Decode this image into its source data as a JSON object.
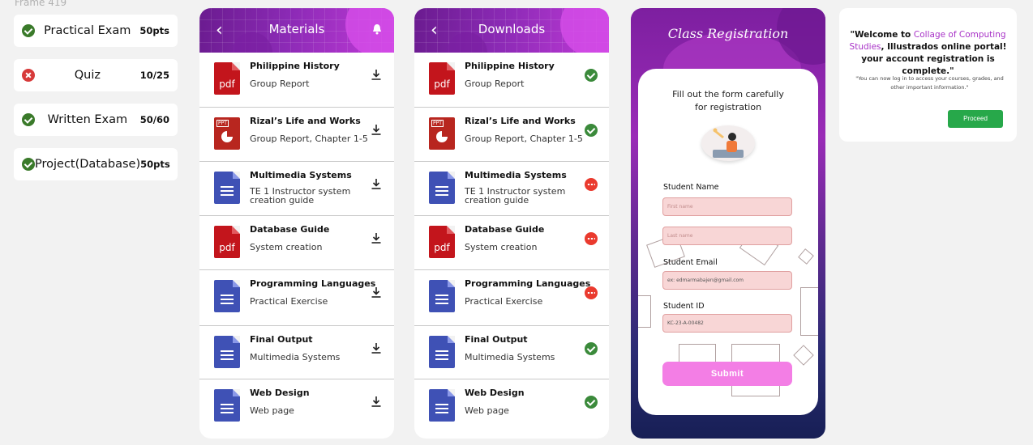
{
  "frame_label": "Frame 419",
  "grades": [
    {
      "status": "passed",
      "name": "Practical Exam",
      "score": "50pts"
    },
    {
      "status": "failed",
      "name": "Quiz",
      "score": "10/25"
    },
    {
      "status": "passed",
      "name": "Written Exam",
      "score": "50/60"
    },
    {
      "status": "passed",
      "name": "Project(Database)",
      "score": "50pts"
    }
  ],
  "materials": {
    "title": "Materials",
    "items": [
      {
        "icon": "pdf-icon",
        "title": "Philippine History",
        "subtitle": "Group Report",
        "action": "download-icon"
      },
      {
        "icon": "ppt-icon",
        "title": "Rizal’s Life and Works",
        "subtitle": "Group Report, Chapter 1-5",
        "action": "download-icon"
      },
      {
        "icon": "doc-icon",
        "title": "Multimedia Systems",
        "subtitle": "TE 1 Instructor system creation guide",
        "action": "download-icon"
      },
      {
        "icon": "pdf-icon",
        "title": "Database Guide",
        "subtitle": "System creation",
        "action": "download-icon"
      },
      {
        "icon": "doc-icon",
        "title": "Programming Languages",
        "subtitle": "Practical Exercise",
        "action": "download-icon"
      },
      {
        "icon": "doc-icon",
        "title": "Final Output",
        "subtitle": "Multimedia Systems",
        "action": "download-icon"
      },
      {
        "icon": "doc-icon",
        "title": "Web Design",
        "subtitle": "Web page",
        "action": "download-icon"
      }
    ]
  },
  "downloads": {
    "title": "Downloads",
    "items": [
      {
        "icon": "pdf-icon",
        "title": "Philippine History",
        "subtitle": "Group Report",
        "status": "done"
      },
      {
        "icon": "ppt-icon",
        "title": "Rizal’s Life and Works",
        "subtitle": "Group Report, Chapter 1-5",
        "status": "done"
      },
      {
        "icon": "doc-icon",
        "title": "Multimedia Systems",
        "subtitle": "TE 1 Instructor system creation guide",
        "status": "pending"
      },
      {
        "icon": "pdf-icon",
        "title": "Database Guide",
        "subtitle": "System creation",
        "status": "pending"
      },
      {
        "icon": "doc-icon",
        "title": "Programming Languages",
        "subtitle": "Practical Exercise",
        "status": "pending"
      },
      {
        "icon": "doc-icon",
        "title": "Final Output",
        "subtitle": "Multimedia Systems",
        "status": "done"
      },
      {
        "icon": "doc-icon",
        "title": "Web Design",
        "subtitle": "Web page",
        "status": "done"
      }
    ]
  },
  "registration": {
    "title": "Class Registration",
    "intro_line1": "Fill out the form carefully",
    "intro_line2": "for registration",
    "name_label": "Student Name",
    "first_name_placeholder": "First name",
    "last_name_placeholder": "Last name",
    "email_label": "Student  Email",
    "email_value": "ex: edmarmabajen@gmail.com",
    "id_label": "Student  ID",
    "id_value": "KC-23-A-00482",
    "submit_label": "Submit"
  },
  "welcome": {
    "prefix": "\"Welcome to ",
    "highlight": "Collage of Computing Studies",
    "suffix": ", Illustrados online portal! your account registration is complete.\"",
    "note": "\"You can now log in to access your courses, grades, and other important information.\"",
    "proceed_label": "Proceed"
  },
  "colors": {
    "header_purple": "#8b2ab5",
    "pass_green": "#3a7a2a",
    "fail_red": "#d73a3a",
    "submit_pink": "#f37ee5",
    "proceed_green": "#27a84a",
    "highlight_purple": "#a832c7"
  }
}
